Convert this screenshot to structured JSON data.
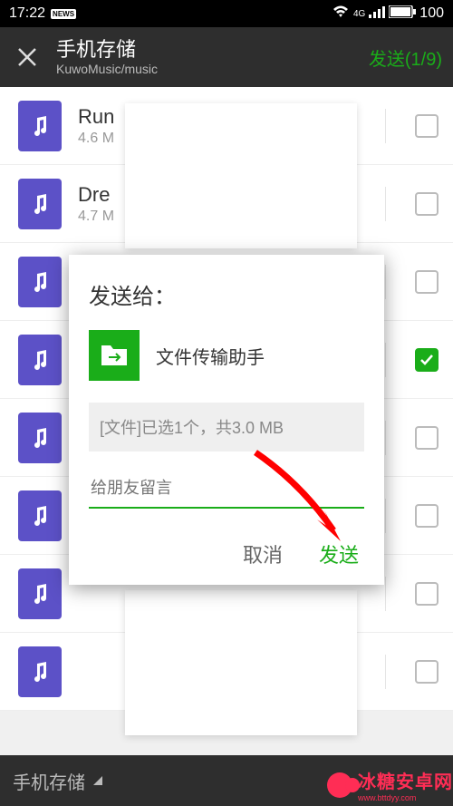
{
  "status": {
    "time": "17:22",
    "battery": "100",
    "network": "4G"
  },
  "header": {
    "title": "手机存储",
    "subtitle": "KuwoMusic/music",
    "send_label": "发送(1/9)"
  },
  "files": [
    {
      "name": "Run",
      "size": "4.6 M",
      "checked": false
    },
    {
      "name": "Dre",
      "size": "4.7 M",
      "checked": false
    },
    {
      "name": "",
      "size": "",
      "checked": false
    },
    {
      "name": "",
      "size": "",
      "checked": true
    },
    {
      "name": "",
      "size": "",
      "checked": false
    },
    {
      "name": "",
      "size": "",
      "checked": false
    },
    {
      "name": "",
      "size": "",
      "checked": false
    },
    {
      "name": "",
      "size": "",
      "checked": false
    }
  ],
  "dialog": {
    "title": "发送给：",
    "recipient": "文件传输助手",
    "summary": "[文件]已选1个，共3.0 MB",
    "placeholder": "给朋友留言",
    "cancel": "取消",
    "send": "发送"
  },
  "bottom": {
    "label": "手机存储"
  },
  "watermark": {
    "text": "冰糖安卓网",
    "url": "www.bttdyy.com"
  },
  "colors": {
    "accent": "#1aad19",
    "file_icon": "#5C51C7"
  }
}
